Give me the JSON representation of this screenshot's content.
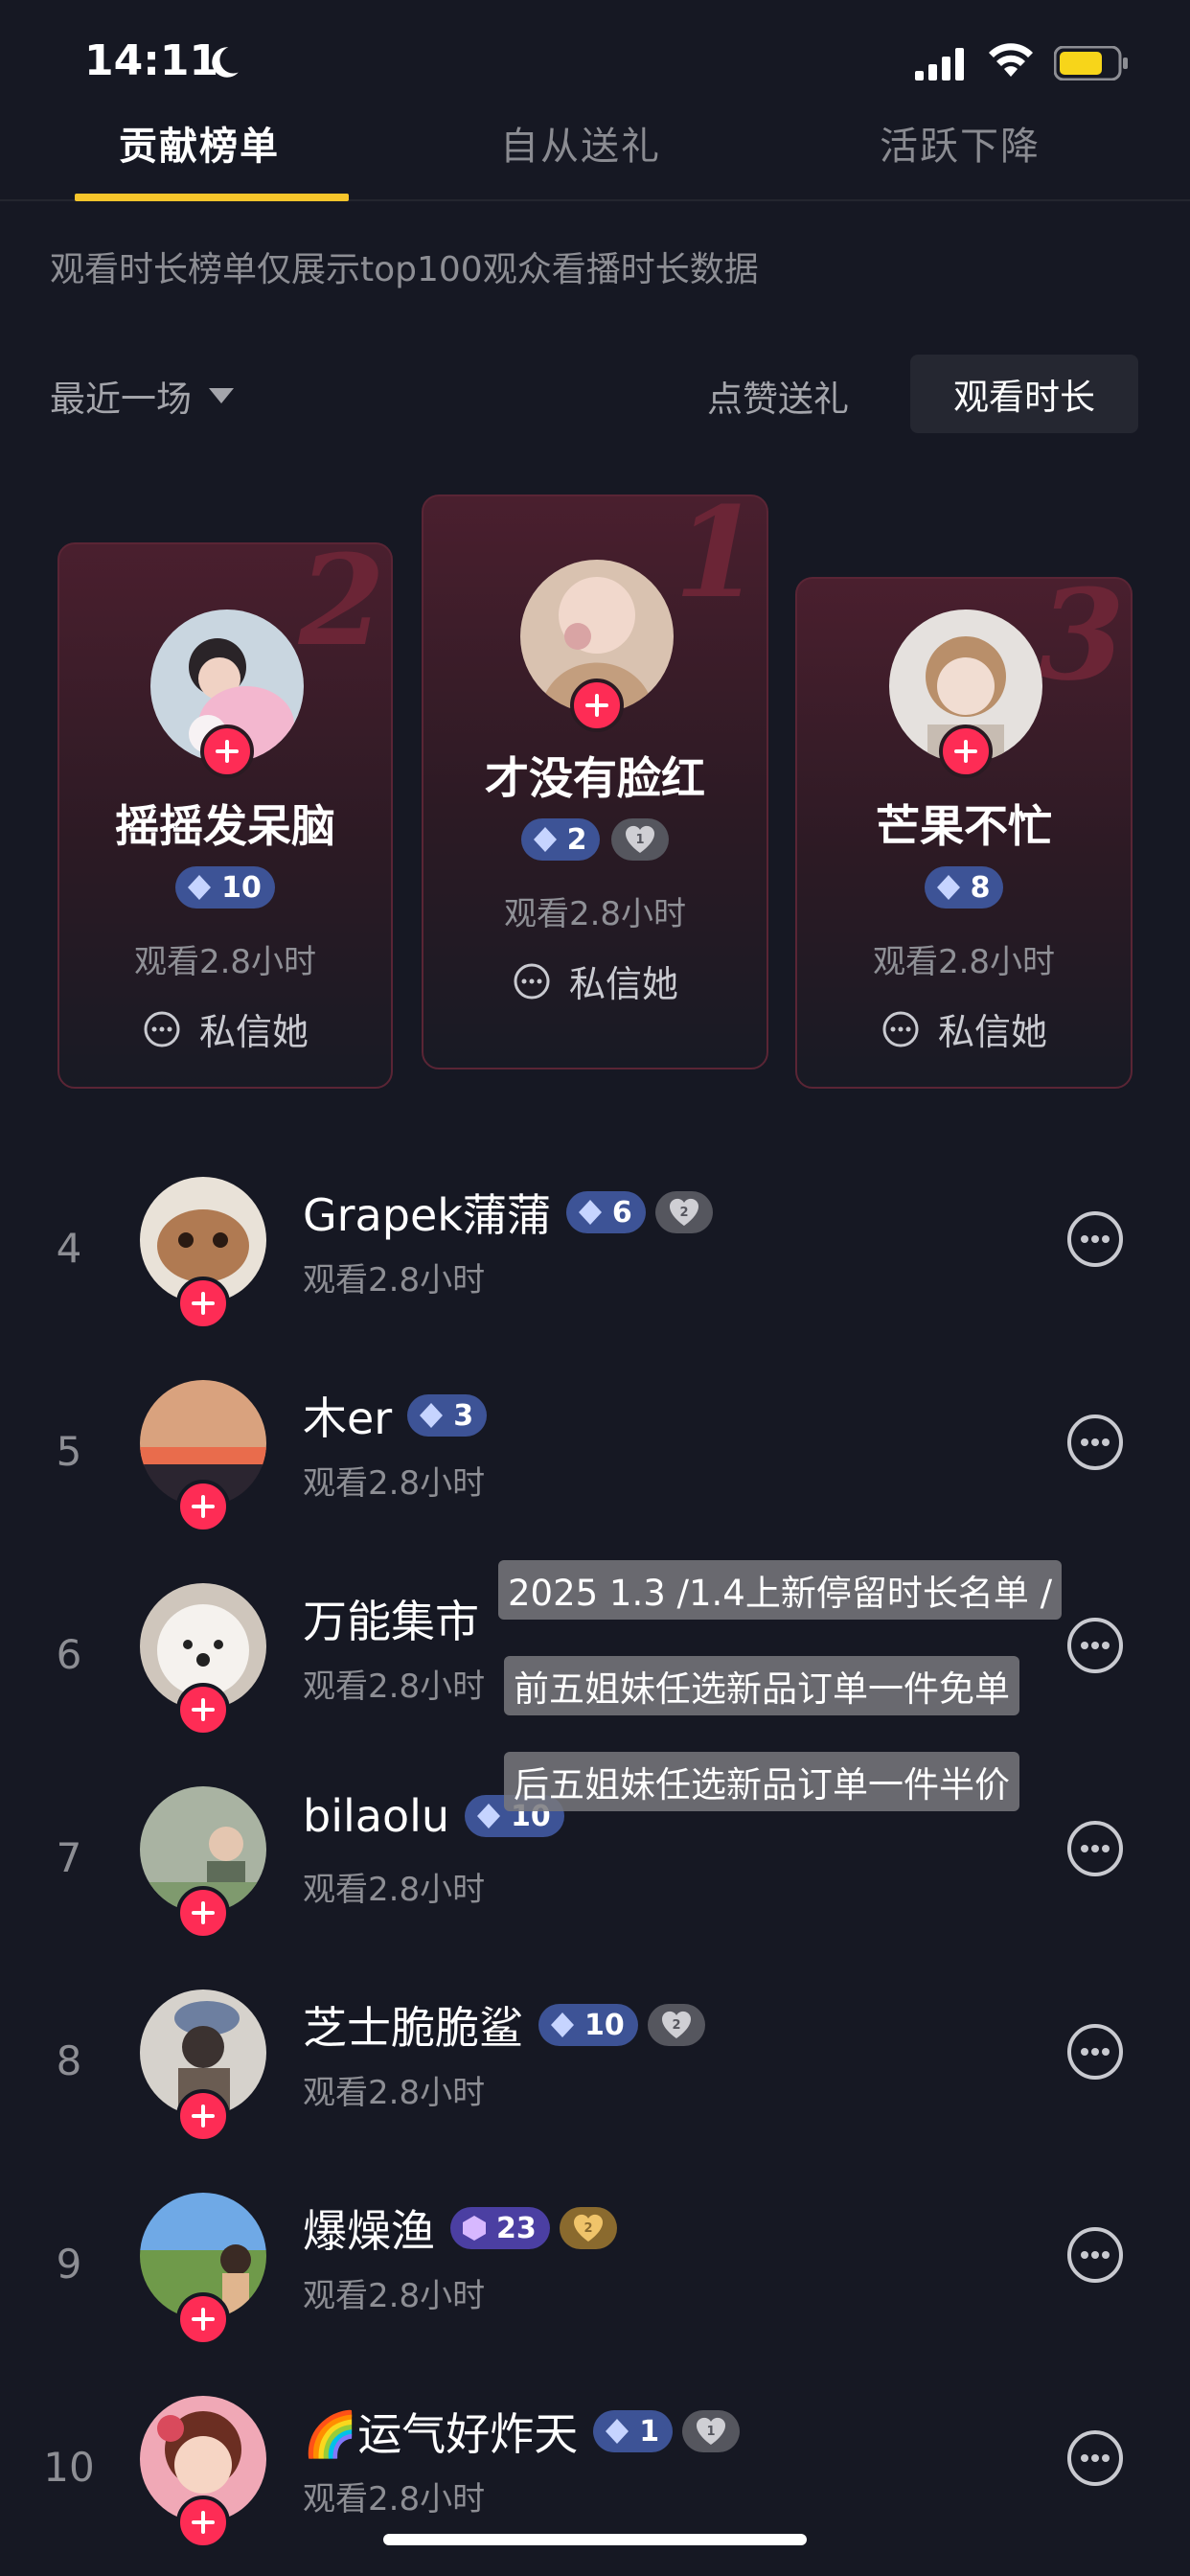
{
  "status_bar": {
    "time": "14:11"
  },
  "tabs": [
    {
      "label": "贡献榜单",
      "active": true
    },
    {
      "label": "自从送礼",
      "active": false
    },
    {
      "label": "活跃下降",
      "active": false
    }
  ],
  "notice": "观看时长榜单仅展示top100观众看播时长数据",
  "filter": {
    "label": "最近一场"
  },
  "sort": {
    "like_gift": "点赞送礼",
    "watch_time": "观看时长"
  },
  "podium": [
    {
      "rank": "2",
      "name": "摇摇发呆脑",
      "level": "10",
      "heart": "",
      "watch": "观看2.8小时",
      "msg": "私信她"
    },
    {
      "rank": "1",
      "name": "才没有脸红",
      "level": "2",
      "heart": "1",
      "watch": "观看2.8小时",
      "msg": "私信她"
    },
    {
      "rank": "3",
      "name": "芒果不忙",
      "level": "8",
      "heart": "",
      "watch": "观看2.8小时",
      "msg": "私信她"
    }
  ],
  "list": [
    {
      "rank": "4",
      "name": "Grapek蒲蒲",
      "level": "6",
      "heart": "2",
      "watch": "观看2.8小时"
    },
    {
      "rank": "5",
      "name": "木er",
      "level": "3",
      "heart": "",
      "watch": "观看2.8小时"
    },
    {
      "rank": "6",
      "name": "万能集市",
      "level": "",
      "heart": "",
      "watch": "观看2.8小时"
    },
    {
      "rank": "7",
      "name": "bilaolu",
      "level": "10",
      "heart": "",
      "watch": "观看2.8小时"
    },
    {
      "rank": "8",
      "name": "芝士脆脆鲨",
      "level": "10",
      "heart": "2",
      "watch": "观看2.8小时"
    },
    {
      "rank": "9",
      "name": "爆燥渔",
      "level": "23",
      "heart": "2",
      "watch": "观看2.8小时"
    },
    {
      "rank": "10",
      "name": "🌈运气好炸天",
      "level": "1",
      "heart": "1",
      "watch": "观看2.8小时"
    }
  ],
  "captions": [
    "2025 1.3 /1.4上新停留时长名单 /",
    "前五姐妹任选新品订单一件免单",
    "后五姐妹任选新品订单一件半价"
  ],
  "colors": {
    "accent": "#f7c52b",
    "follow": "#fe2c55",
    "background": "#161823"
  }
}
